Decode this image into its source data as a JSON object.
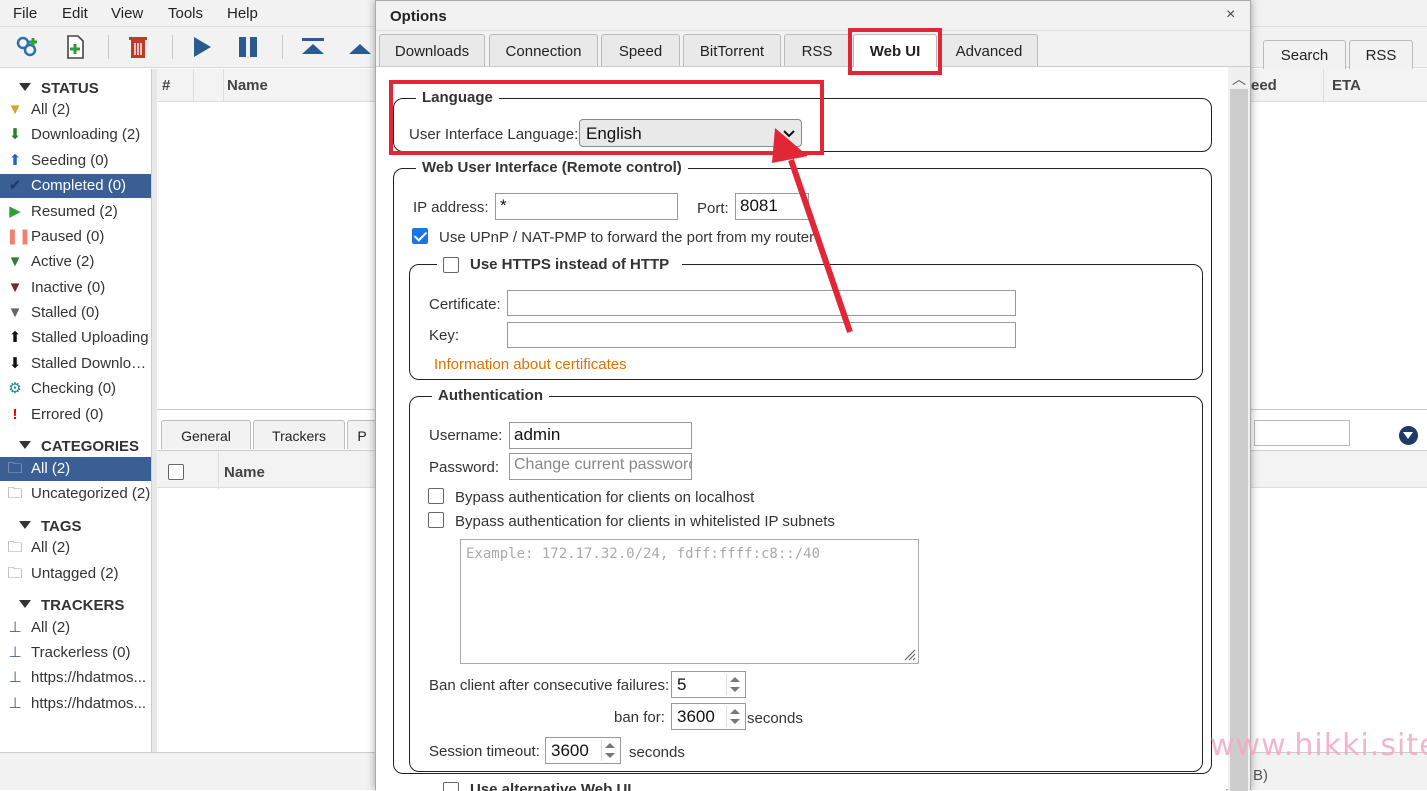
{
  "menu": [
    "File",
    "Edit",
    "View",
    "Tools",
    "Help"
  ],
  "sidebar": {
    "status_title": "STATUS",
    "status_items": [
      "All (2)",
      "Downloading (2)",
      "Seeding (0)",
      "Completed (0)",
      "Resumed (2)",
      "Paused (0)",
      "Active (2)",
      "Inactive (0)",
      "Stalled (0)",
      "Stalled Uploading",
      "Stalled Downloading",
      "Checking (0)",
      "Errored (0)"
    ],
    "categories_title": "CATEGORIES",
    "category_items": [
      "All (2)",
      "Uncategorized (2)"
    ],
    "tags_title": "TAGS",
    "tag_items": [
      "All (2)",
      "Untagged (2)"
    ],
    "trackers_title": "TRACKERS",
    "tracker_items": [
      "All (2)",
      "Trackerless (0)",
      "https://hdatmos...",
      "https://hdatmos..."
    ]
  },
  "torrent_list": {
    "col_hash": "#",
    "col_name": "Name",
    "col_speed": "eed",
    "col_eta": "ETA"
  },
  "right_tabs": {
    "search": "Search",
    "rss": "RSS"
  },
  "bottom": {
    "tabs": [
      "General",
      "Trackers",
      "P"
    ],
    "col_name": "Name"
  },
  "status_right": "B)",
  "dialog": {
    "title": "Options",
    "close": "×",
    "tabs": [
      "Downloads",
      "Connection",
      "Speed",
      "BitTorrent",
      "RSS",
      "Web UI",
      "Advanced"
    ],
    "active_tab": "Web UI",
    "language": {
      "legend": "Language",
      "label": "User Interface Language:",
      "value": "English"
    },
    "webui": {
      "legend": "Web User Interface (Remote control)",
      "ip_label": "IP address:",
      "ip_value": "*",
      "port_label": "Port:",
      "port_value": "8081",
      "upnp_label": "Use UPnP / NAT-PMP to forward the port from my router",
      "upnp_checked": true
    },
    "https": {
      "legend": "Use HTTPS instead of HTTP",
      "cert_label": "Certificate:",
      "key_label": "Key:",
      "info_link": "Information about certificates"
    },
    "auth": {
      "legend": "Authentication",
      "username_label": "Username:",
      "username_value": "admin",
      "password_label": "Password:",
      "password_placeholder": "Change current password",
      "bypass_local": "Bypass authentication for clients on localhost",
      "bypass_whitelist": "Bypass authentication for clients in whitelisted IP subnets",
      "subnets_placeholder": "Example: 172.17.32.0/24, fdff:ffff:c8::/40",
      "ban_label": "Ban client after consecutive failures:",
      "ban_value": "5",
      "banfor_label": "ban for:",
      "banfor_value": "3600",
      "banfor_unit": "seconds",
      "session_label": "Session timeout:",
      "session_value": "3600",
      "session_unit": "seconds"
    },
    "alt_webui": "Use alternative Web UI"
  },
  "colors": {
    "accent_red": "#e32636",
    "selected": "#3a5f95",
    "link": "#e07000"
  },
  "watermark": "www.hikki.site"
}
